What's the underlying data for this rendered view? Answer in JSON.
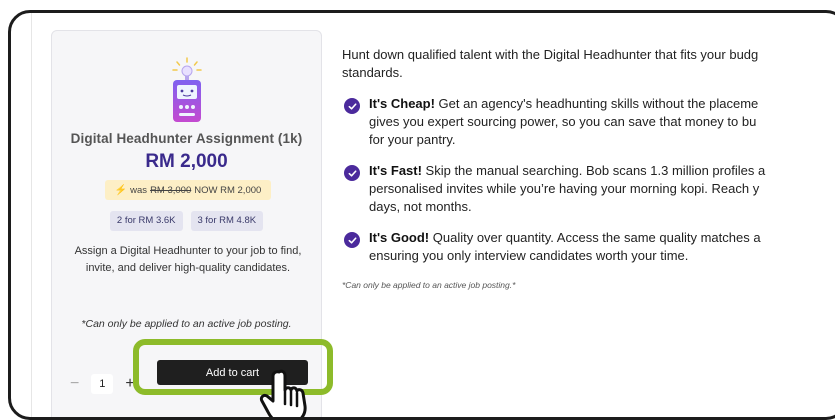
{
  "product": {
    "icon": "robot-device-icon",
    "title": "Digital Headhunter Assignment (1k)",
    "price": "RM 2,000",
    "promo": {
      "icon": "lightning-icon",
      "was_label": "was",
      "old_price": "RM 3,000",
      "now_text": "NOW RM 2,000"
    },
    "bundles": [
      "2 for RM 3.6K",
      "3 for RM 4.8K"
    ],
    "description": "Assign a Digital Headhunter to your job to find, invite, and deliver high-quality candidates.",
    "note": "*Can only be applied to an active job posting.",
    "quantity": {
      "minus": "−",
      "value": "1",
      "plus": "+"
    },
    "add_to_cart": "Add to cart",
    "colors": {
      "accent": "#3a2a8c",
      "highlight": "#8dbb2a",
      "promo_bg": "#fdefc6",
      "button_bg": "#1f1f1f"
    }
  },
  "details": {
    "intro_lines": [
      "Hunt down qualified talent with the Digital Headhunter that fits your budg",
      "standards."
    ],
    "benefits": [
      {
        "title": "It's Cheap!",
        "lines": [
          " Get an agency's headhunting skills without the placeme",
          "gives you expert sourcing power, so you can save that money to bu",
          "for your pantry."
        ]
      },
      {
        "title": "It's Fast!",
        "lines": [
          " Skip the manual searching. Bob scans 1.3 million profiles a",
          "personalised invites while you’re having your morning kopi. Reach y",
          "days, not months."
        ]
      },
      {
        "title": "It's Good!",
        "lines": [
          " Quality over quantity. Access the same quality matches a",
          "ensuring you only interview candidates worth your time."
        ]
      }
    ],
    "note": "*Can only be applied to an active job posting.*"
  }
}
